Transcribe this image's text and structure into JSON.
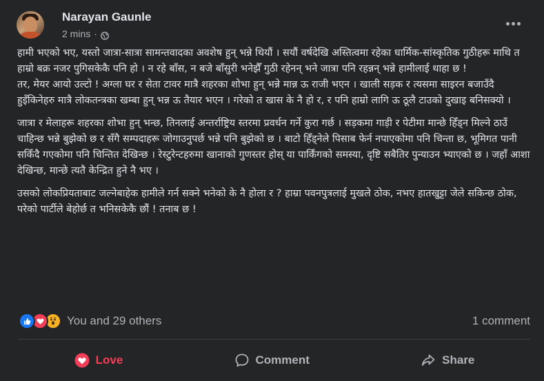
{
  "post": {
    "author": "Narayan Gaunle",
    "time": "2 mins",
    "separator": "·",
    "privacy_icon": "globe-icon",
    "paragraphs": [
      "हामी भएको भए, यस्तो जात्रा-सात्रा सामन्तवादका अवशेष हुन् भन्ने थियौं । सयौं वर्षदेखि अस्तित्वमा रहेका धार्मिक-सांस्कृतिक गुठीहरू माथि त हाम्रो बक्र नजर पुगिसकेकै पनि हो । न रहे बाँस, न बजे बाँसुरी भनेझैँ गुठी रहेनन् भने जात्रा पनि रहन्नन् भन्ने हामीलाई थाहा छ !",
      "तर, मेयर आयो उल्टो ! अग्ला घर र सेता टावर मात्रै शहरका शोभा हुन् भन्ने मान्न ऊ राजी भएन । खाली सड़क र त्यसमा साइरन बजाउँदै हुइँकिनेहरु मात्रै लोकतन्त्रका खम्बा हुन् भन्न ऊ तैयार भएन । गरेको त खास के नै हो र, र पनि हाम्रो लागि ऊ ठूलै टाउको दुखाइ बनिसक्यो ।",
      "जात्रा र मेलाहरू शहरका शोभा हुन् भन्छ, तिनलाई अन्तर्राष्ट्रिय स्तरमा प्रवर्धन गर्ने कुरा गर्छ । सड़कमा गाड़ी र पेटीमा मान्छे हिँड्न मिल्ने ठाउँ चाहिन्छ भन्ने बुझेको छ र सँगै सम्पदाहरू जोगाउनुपर्छ भन्ने पनि बुझेको छ । बाटो हिँड्नेले पिसाब फेर्न नपाएकोमा पनि चिन्ता छ, भूमिगत पानी सकिँदै गएकोमा पनि चिन्तित देखिन्छ । रेस्टुरेन्टहरुमा खानाको गुणस्तर होस् या पार्किंगको समस्या, दृष्टि सबैतिर पुन्याउन भ्याएको छ । जहाँ आशा देखिन्छ, मान्छे त्यतै केन्द्रित हुने नै भए ।",
      "उसको लोकप्रियताबाट जल्नेबाहेक हामीले गर्न सक्ने भनेको के नै होला र ? हाम्रा पवनपुत्रलाई मुखले ठोक, नभए हातखुट्टा जेले सकिन्छ ठोक, परेको पार्टीले बेहोर्छ त भनिसकेकै छौं ! तनाब छ !"
    ]
  },
  "reactions": {
    "icons": [
      "like-icon",
      "love-icon",
      "wow-icon"
    ],
    "summary": "You and 29 others",
    "comments": "1 comment"
  },
  "actions": {
    "love_label": "Love",
    "comment_label": "Comment",
    "share_label": "Share"
  },
  "colors": {
    "background": "#242526",
    "text_primary": "#e4e6eb",
    "text_secondary": "#b0b3b8",
    "love": "#f33e58",
    "like": "#1877f2",
    "wow": "#f7b125",
    "divider": "#3e4042"
  }
}
